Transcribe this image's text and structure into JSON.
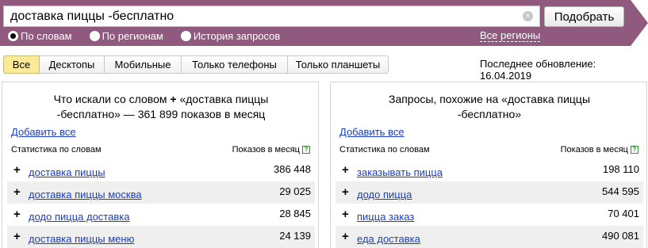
{
  "search": {
    "value": "доставка пиццы -бесплатно",
    "button_label": "Подобрать",
    "clear_icon": "×"
  },
  "modes": [
    {
      "label": "По словам",
      "checked": true
    },
    {
      "label": "По регионам",
      "checked": false
    },
    {
      "label": "История запросов",
      "checked": false
    }
  ],
  "regions_link": "Все регионы",
  "tabs": [
    {
      "label": "Все",
      "active": true
    },
    {
      "label": "Десктопы",
      "active": false
    },
    {
      "label": "Мобильные",
      "active": false
    },
    {
      "label": "Только телефоны",
      "active": false
    },
    {
      "label": "Только планшеты",
      "active": false
    }
  ],
  "last_update": "Последнее обновление: 16.04.2019",
  "left_panel": {
    "title_line1_a": "Что искали со словом",
    "title_plus": "+",
    "title_line1_b": "«доставка пиццы",
    "title_line2": "-бесплатно» — 361 899 показов в месяц",
    "add_all": "Добавить все",
    "col_left": "Статистика по словам",
    "col_right": "Показов в месяц",
    "rows": [
      {
        "phrase": "доставка пиццы",
        "count": "386 448"
      },
      {
        "phrase": "доставка пиццы москва",
        "count": "29 025"
      },
      {
        "phrase": "додо пицца доставка",
        "count": "28 845"
      },
      {
        "phrase": "доставка пиццы меню",
        "count": "24 139"
      }
    ]
  },
  "right_panel": {
    "title_line1": "Запросы, похожие на «доставка пиццы",
    "title_line2": "-бесплатно»",
    "add_all": "Добавить все",
    "col_left": "Статистика по словам",
    "col_right": "Показов в месяц",
    "rows": [
      {
        "phrase": "заказывать пицца",
        "count": "198 110"
      },
      {
        "phrase": "додо пицца",
        "count": "544 595"
      },
      {
        "phrase": "пицца заказ",
        "count": "70 401"
      },
      {
        "phrase": "еда доставка",
        "count": "490 081"
      }
    ]
  },
  "colors": {
    "topbar": "#8f5a7e",
    "link": "#1a3dc1",
    "active_tab": "#fbeb96",
    "alt_row": "#efefef"
  },
  "icons": {
    "help": "?",
    "row_plus": "+"
  }
}
